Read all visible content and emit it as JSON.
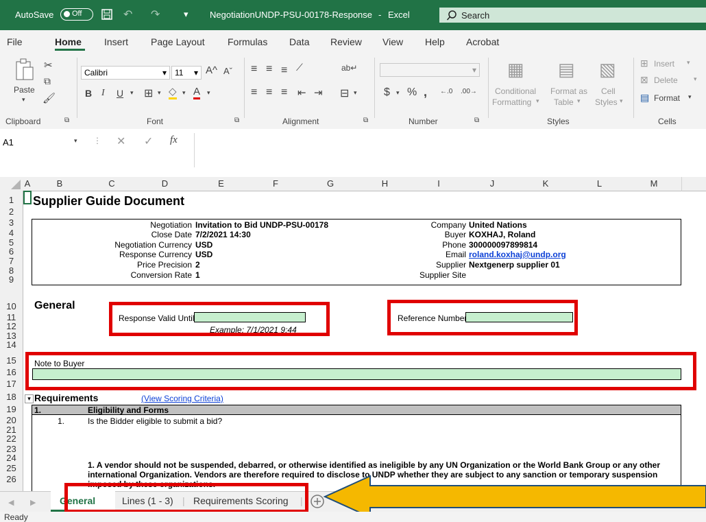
{
  "titlebar": {
    "autosave": "AutoSave",
    "autosave_state": "Off",
    "doc_title": "NegotiationUNDP-PSU-00178-Response",
    "app": "Excel",
    "search": "Search"
  },
  "menu": [
    "File",
    "Home",
    "Insert",
    "Page Layout",
    "Formulas",
    "Data",
    "Review",
    "View",
    "Help",
    "Acrobat"
  ],
  "ribbon": {
    "paste": "Paste",
    "clipboard": "Clipboard",
    "font_name": "Calibri",
    "font_size": "11",
    "font": "Font",
    "alignment": "Alignment",
    "number": "Number",
    "conditional": "Conditional",
    "formatting": "Formatting",
    "format_as": "Format as",
    "table": "Table",
    "cell": "Cell",
    "styles_btn": "Styles",
    "styles": "Styles",
    "insert": "Insert",
    "delete": "Delete",
    "format": "Format",
    "cells": "Cells"
  },
  "formula": {
    "namebox": "A1",
    "fx": "fx"
  },
  "columns": [
    "A",
    "B",
    "C",
    "D",
    "E",
    "F",
    "G",
    "H",
    "I",
    "J",
    "K",
    "L",
    "M"
  ],
  "rows": [
    "1",
    "2",
    "3",
    "4",
    "5",
    "6",
    "7",
    "8",
    "9",
    "10",
    "11",
    "12",
    "13",
    "14",
    "15",
    "16",
    "17",
    "18",
    "19",
    "20",
    "21",
    "22",
    "23",
    "24",
    "25",
    "26"
  ],
  "sheet": {
    "title": "Supplier Guide Document",
    "left_info": [
      {
        "label": "Negotiation",
        "value": "Invitation to Bid UNDP-PSU-00178"
      },
      {
        "label": "Close Date",
        "value": "7/2/2021 14:30"
      },
      {
        "label": "Negotiation Currency",
        "value": "USD"
      },
      {
        "label": "Response Currency",
        "value": "USD"
      },
      {
        "label": "Price Precision",
        "value": "2"
      },
      {
        "label": "Conversion Rate",
        "value": "1"
      }
    ],
    "right_info": [
      {
        "label": "Company",
        "value": "United Nations"
      },
      {
        "label": "Buyer",
        "value": "KOXHAJ, Roland"
      },
      {
        "label": "Phone",
        "value": "300000097899814"
      },
      {
        "label": "Email",
        "value": "roland.koxhaj@undp.org"
      },
      {
        "label": "Supplier",
        "value": "Nextgenerp supplier 01"
      },
      {
        "label": "Supplier Site",
        "value": ""
      }
    ],
    "general": "General",
    "response_valid": "Response Valid Until",
    "example": "Example:  7/1/2021 9:44",
    "reference": "Reference Number",
    "note_to_buyer": "Note to Buyer",
    "requirements": "Requirements",
    "view_scoring": "(View Scoring Criteria)",
    "section_num": "1.",
    "section_title": "Eligibility and Forms",
    "q_num": "1.",
    "question": "Is the Bidder eligible to submit a bid?",
    "para_line1": "1.   A vendor should not be suspended, debarred, or otherwise identified as ineligible by any UN Organization or the World Bank Group or any other",
    "para_line2": "international Organization. Vendors are therefore required to disclose to UNDP whether they are subject to any sanction or temporary suspension",
    "para_line3": "imposed by these organizations."
  },
  "tabs": [
    "General",
    "Lines (1 - 3)",
    "Requirements Scoring"
  ],
  "status": "Ready",
  "colors": {
    "excel_green": "#217346",
    "highlight_red": "#e00000",
    "arrow": "#f5b800",
    "input_green": "#c6efce"
  }
}
